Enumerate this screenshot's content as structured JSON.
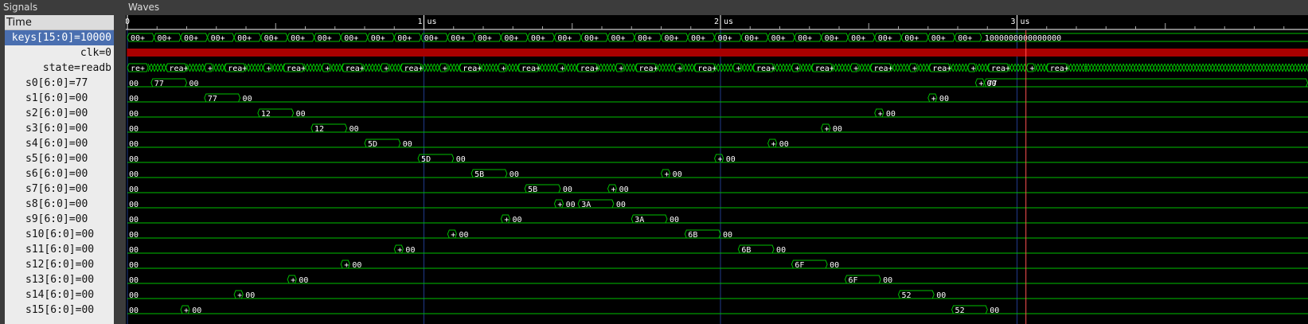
{
  "panes": {
    "signals_title": "Signals",
    "waves_title": "Waves"
  },
  "time_header": "Time",
  "time_axis": {
    "ticks": [
      {
        "label": "0",
        "t": 0
      },
      {
        "label": "1 us",
        "t": 1000
      },
      {
        "label": "2 us",
        "t": 2000
      },
      {
        "label": "3 us",
        "t": 3000
      }
    ],
    "cursor_t": 3030
  },
  "colors": {
    "wave": "#00c000",
    "text": "#ffffff",
    "cursor": "#ff5050",
    "grid": "#1f3a8a",
    "clk": "#e00000"
  },
  "signals": [
    {
      "label": "keys[15:0]",
      "value": "=10000",
      "selected": true
    },
    {
      "label": "clk",
      "value": "=0"
    },
    {
      "label": "state",
      "value": "=readb"
    },
    {
      "label": "s0[6:0]",
      "value": "=77"
    },
    {
      "label": "s1[6:0]",
      "value": "=00"
    },
    {
      "label": "s2[6:0]",
      "value": "=00"
    },
    {
      "label": "s3[6:0]",
      "value": "=00"
    },
    {
      "label": "s4[6:0]",
      "value": "=00"
    },
    {
      "label": "s5[6:0]",
      "value": "=00"
    },
    {
      "label": "s6[6:0]",
      "value": "=00"
    },
    {
      "label": "s7[6:0]",
      "value": "=00"
    },
    {
      "label": "s8[6:0]",
      "value": "=00"
    },
    {
      "label": "s9[6:0]",
      "value": "=00"
    },
    {
      "label": "s10[6:0]",
      "value": "=00"
    },
    {
      "label": "s11[6:0]",
      "value": "=00"
    },
    {
      "label": "s12[6:0]",
      "value": "=00"
    },
    {
      "label": "s13[6:0]",
      "value": "=00"
    },
    {
      "label": "s14[6:0]",
      "value": "=00"
    },
    {
      "label": "s15[6:0]",
      "value": "=00"
    }
  ],
  "waves": {
    "keys_labels": [
      "00+",
      "00+",
      "00+",
      "00+",
      "00+",
      "00+",
      "00+",
      "00+",
      "00+",
      "00+",
      "00+",
      "00+",
      "00+",
      "00+",
      "00+",
      "00+",
      "00+",
      "00+",
      "00+",
      "00+",
      "00+",
      "00+",
      "00+",
      "00+",
      "00+",
      "00+",
      "00+",
      "00+",
      "00+",
      "00+",
      "00+",
      "00+"
    ],
    "keys_last": "1000000000000000",
    "state_labels": [
      "re+",
      "rea+",
      "+",
      "rea+",
      "+",
      "rea+",
      "+",
      "rea+",
      "+",
      "rea+",
      "+",
      "rea+",
      "+",
      "rea+",
      "+",
      "rea+",
      "+",
      "rea+",
      "+",
      "rea+",
      "+",
      "rea+",
      "+",
      "rea+",
      "+",
      "rea+",
      "+",
      "rea+",
      "+",
      "rea+",
      "+",
      "rea+"
    ],
    "registers": [
      {
        "base": "00",
        "segments": [
          {
            "t0": 80,
            "t1": 200,
            "label": "77"
          },
          {
            "t0": 2860,
            "t1": 2890,
            "label": "+"
          },
          {
            "t0": 2890,
            "t1": 3980,
            "label": "77"
          }
        ]
      },
      {
        "base": "00",
        "segments": [
          {
            "t0": 260,
            "t1": 380,
            "label": "77"
          },
          {
            "t0": 2700,
            "t1": 2730,
            "label": "+"
          }
        ]
      },
      {
        "base": "00",
        "segments": [
          {
            "t0": 440,
            "t1": 560,
            "label": "12"
          },
          {
            "t0": 2520,
            "t1": 2550,
            "label": "+"
          }
        ]
      },
      {
        "base": "00",
        "segments": [
          {
            "t0": 620,
            "t1": 740,
            "label": "12"
          },
          {
            "t0": 2340,
            "t1": 2370,
            "label": "+"
          }
        ]
      },
      {
        "base": "00",
        "segments": [
          {
            "t0": 800,
            "t1": 920,
            "label": "5D"
          },
          {
            "t0": 2160,
            "t1": 2190,
            "label": "+"
          }
        ]
      },
      {
        "base": "00",
        "segments": [
          {
            "t0": 980,
            "t1": 1100,
            "label": "5D"
          },
          {
            "t0": 1980,
            "t1": 2010,
            "label": "+"
          }
        ]
      },
      {
        "base": "00",
        "segments": [
          {
            "t0": 1160,
            "t1": 1280,
            "label": "5B"
          },
          {
            "t0": 1800,
            "t1": 1830,
            "label": "+"
          }
        ]
      },
      {
        "base": "00",
        "segments": [
          {
            "t0": 1340,
            "t1": 1460,
            "label": "5B"
          },
          {
            "t0": 1620,
            "t1": 1650,
            "label": "+"
          }
        ]
      },
      {
        "base": "00",
        "segments": [
          {
            "t0": 1440,
            "t1": 1470,
            "label": "+"
          },
          {
            "t0": 1520,
            "t1": 1640,
            "label": "3A"
          }
        ]
      },
      {
        "base": "00",
        "segments": [
          {
            "t0": 1260,
            "t1": 1290,
            "label": "+"
          },
          {
            "t0": 1700,
            "t1": 1820,
            "label": "3A"
          }
        ]
      },
      {
        "base": "00",
        "segments": [
          {
            "t0": 1080,
            "t1": 1110,
            "label": "+"
          },
          {
            "t0": 1880,
            "t1": 2000,
            "label": "6B"
          }
        ]
      },
      {
        "base": "00",
        "segments": [
          {
            "t0": 900,
            "t1": 930,
            "label": "+"
          },
          {
            "t0": 2060,
            "t1": 2180,
            "label": "6B"
          }
        ]
      },
      {
        "base": "00",
        "segments": [
          {
            "t0": 720,
            "t1": 750,
            "label": "+"
          },
          {
            "t0": 2240,
            "t1": 2360,
            "label": "6F"
          }
        ]
      },
      {
        "base": "00",
        "segments": [
          {
            "t0": 540,
            "t1": 570,
            "label": "+"
          },
          {
            "t0": 2420,
            "t1": 2540,
            "label": "6F"
          }
        ]
      },
      {
        "base": "00",
        "segments": [
          {
            "t0": 360,
            "t1": 390,
            "label": "+"
          },
          {
            "t0": 2600,
            "t1": 2720,
            "label": "52"
          }
        ]
      },
      {
        "base": "00",
        "segments": [
          {
            "t0": 180,
            "t1": 210,
            "label": "+"
          },
          {
            "t0": 2780,
            "t1": 2900,
            "label": "52"
          }
        ]
      }
    ]
  }
}
